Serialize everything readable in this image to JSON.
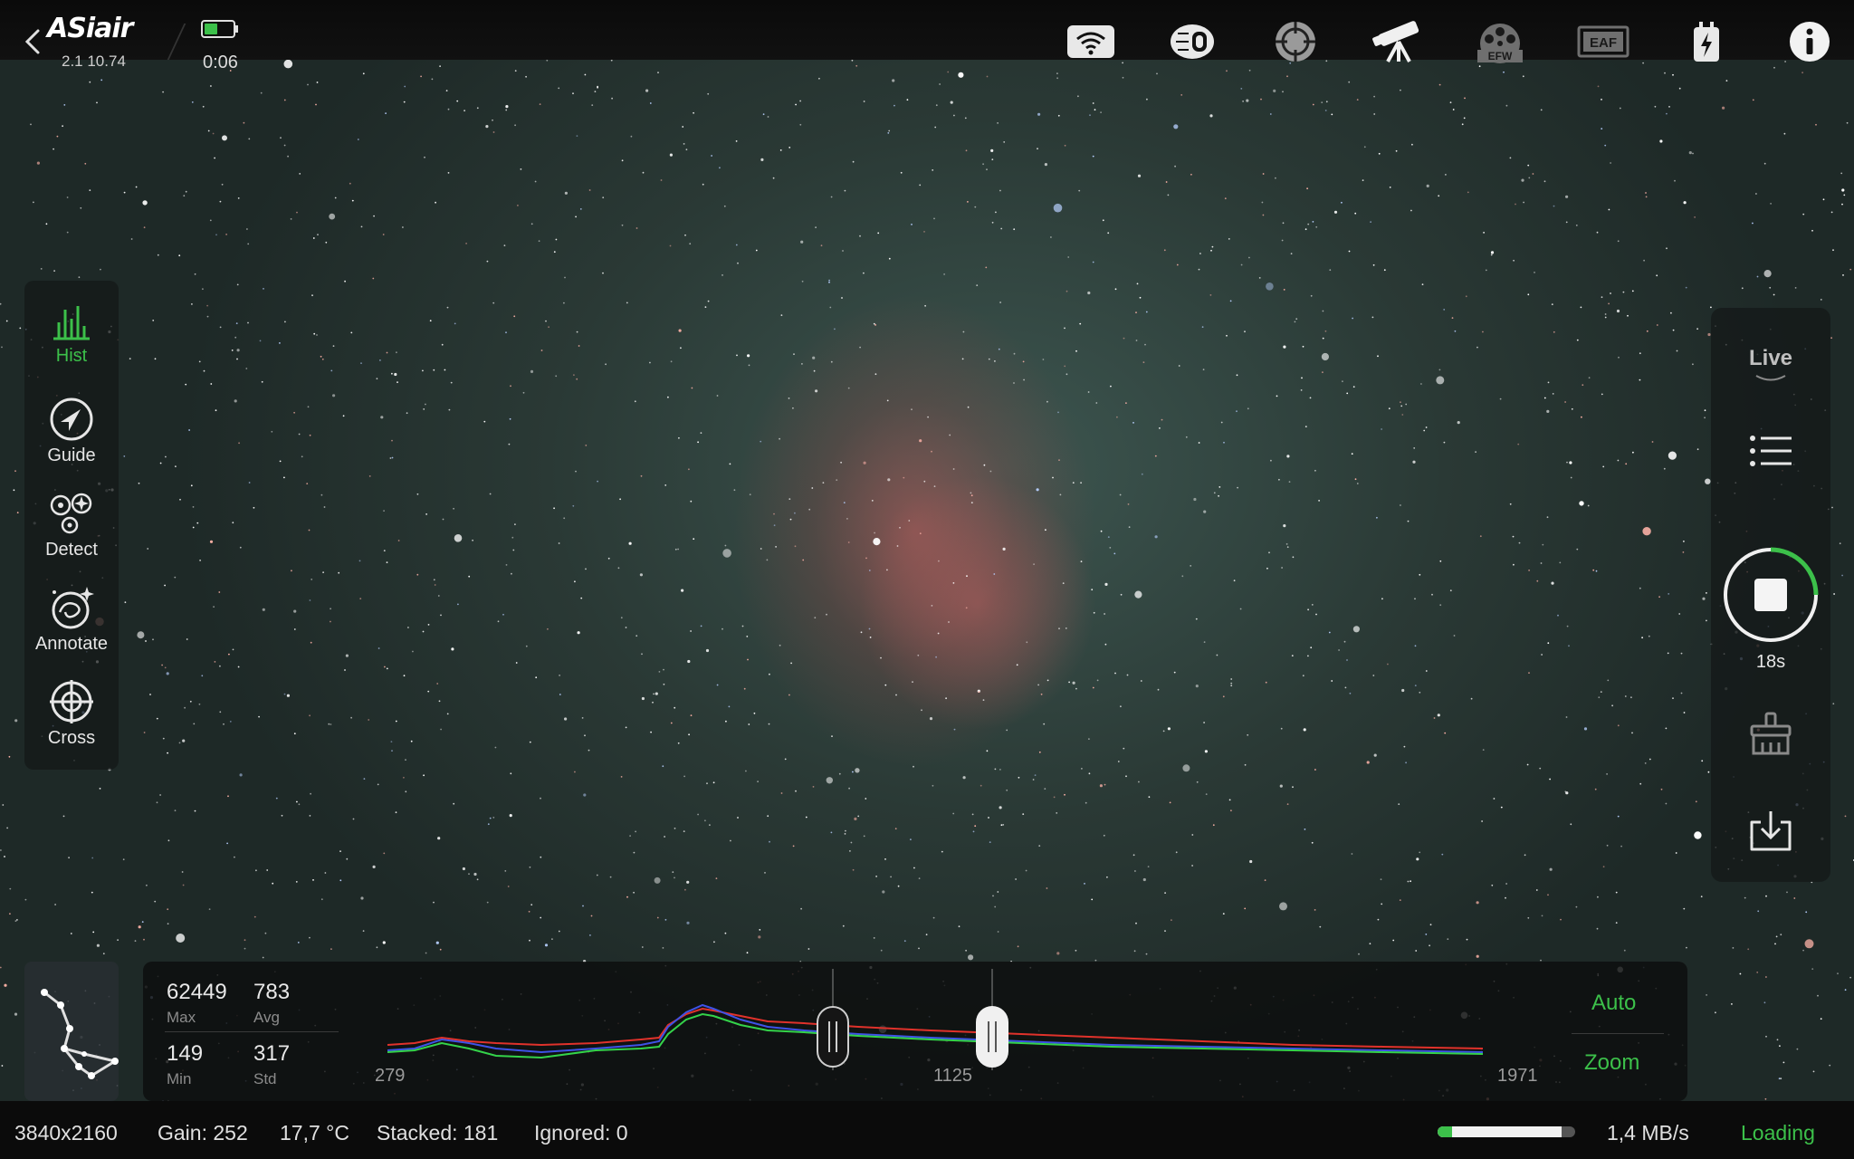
{
  "app": {
    "logo": "ASiair",
    "version": "2.1 10.74",
    "elapsed": "0:06"
  },
  "topbar": {
    "icons": [
      "wifi-icon",
      "camera-icon",
      "guide-scope-icon",
      "telescope-icon",
      "efw-icon",
      "eaf-icon",
      "power-icon",
      "info-icon"
    ],
    "efw_label": "EFW",
    "eaf_label": "EAF"
  },
  "left_tools": {
    "hist": "Hist",
    "guide": "Guide",
    "detect": "Detect",
    "annotate": "Annotate",
    "cross": "Cross"
  },
  "right_panel": {
    "mode": "Live",
    "exposure": "18s"
  },
  "histogram": {
    "max_value": "62449",
    "max_label": "Max",
    "avg_value": "783",
    "avg_label": "Avg",
    "min_value": "149",
    "min_label": "Min",
    "std_value": "317",
    "std_label": "Std",
    "axis_left": "279",
    "axis_mid": "1125",
    "axis_right": "1971",
    "auto_label": "Auto",
    "zoom_label": "Zoom"
  },
  "status": {
    "resolution": "3840x2160",
    "gain": "Gain: 252",
    "temperature": "17,7 °C",
    "stacked": "Stacked: 181",
    "ignored": "Ignored: 0",
    "transfer_rate": "1,4 MB/s",
    "loading": "Loading",
    "transfer_progress": 0.9
  },
  "colors": {
    "accent_green": "#3cc04a",
    "hist_red": "#e0322b",
    "hist_blue": "#3e52e6",
    "hist_green": "#34d34a"
  }
}
